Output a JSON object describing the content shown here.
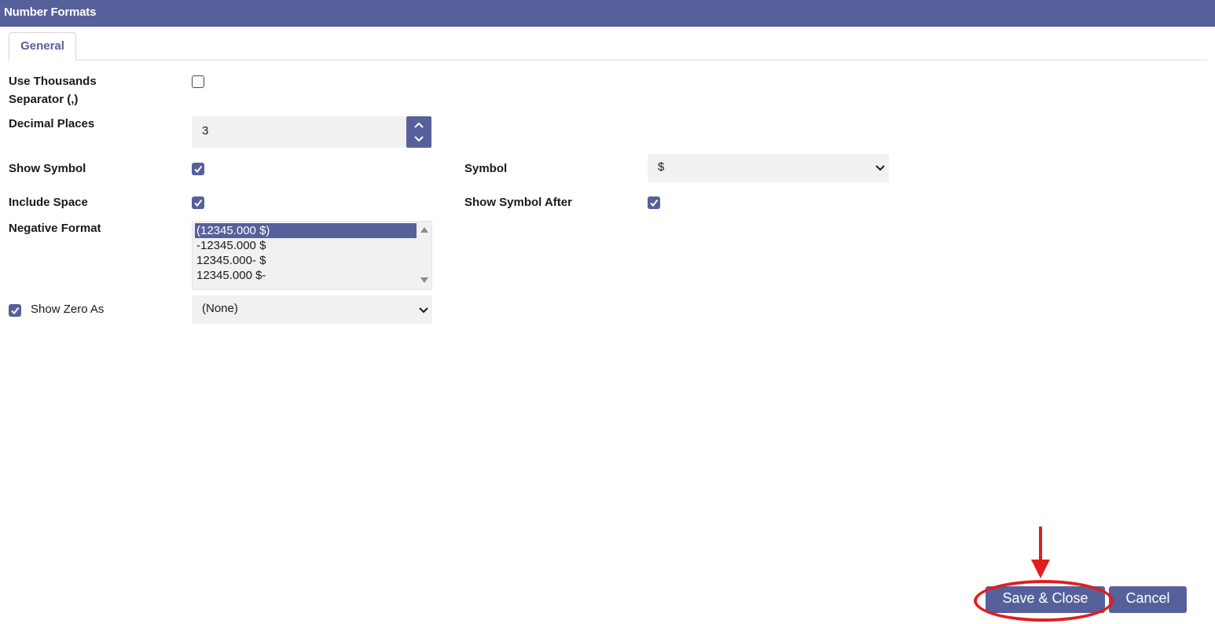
{
  "window": {
    "title": "Number Formats"
  },
  "tabs": [
    {
      "label": "General"
    }
  ],
  "form": {
    "thousands_separator": {
      "label_line1": "Use Thousands",
      "label_line2": "Separator (,)",
      "checked": false
    },
    "decimal_places": {
      "label": "Decimal Places",
      "value": "3"
    },
    "show_symbol": {
      "label": "Show Symbol",
      "checked": true
    },
    "symbol": {
      "label": "Symbol",
      "value": "$"
    },
    "include_space": {
      "label": "Include Space",
      "checked": true
    },
    "show_symbol_after": {
      "label": "Show Symbol After",
      "checked": true
    },
    "negative_format": {
      "label": "Negative Format",
      "options": [
        "(12345.000 $)",
        "-12345.000 $",
        "12345.000- $",
        "12345.000 $-"
      ],
      "selected_index": 0
    },
    "show_zero_as": {
      "label": "Show Zero As",
      "checked": true,
      "value": "(None)"
    }
  },
  "buttons": {
    "save_close": "Save & Close",
    "cancel": "Cancel"
  },
  "colors": {
    "accent": "#56609b",
    "annotation": "#e01e1e",
    "field_bg": "#f1f1f1"
  },
  "icons": [
    "check-icon",
    "chevron-up-icon",
    "chevron-down-icon",
    "scroll-up-icon",
    "scroll-down-icon",
    "arrow-down-icon"
  ]
}
